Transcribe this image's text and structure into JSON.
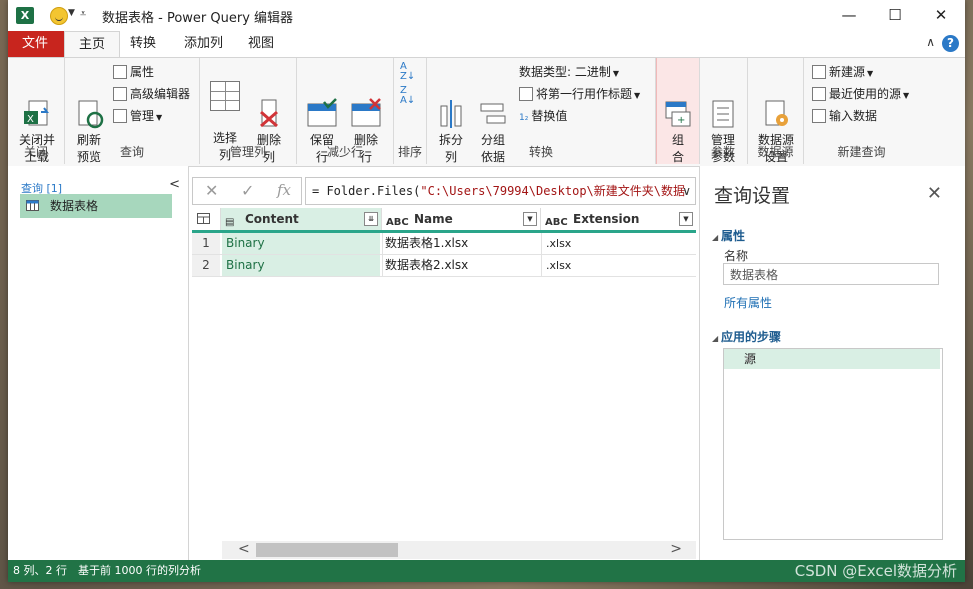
{
  "window": {
    "title": "数据表格 - Power Query 编辑器",
    "app_icon_letter": "X",
    "controls": {
      "minimize": "—",
      "maximize": "☐",
      "close": "✕"
    }
  },
  "tabs": [
    {
      "label": "文件"
    },
    {
      "label": "主页"
    },
    {
      "label": "转换"
    },
    {
      "label": "添加列"
    },
    {
      "label": "视图"
    }
  ],
  "ribbon": {
    "close_group": {
      "label": "关闭",
      "close_load": "关闭并\n上载"
    },
    "query_group": {
      "label": "查询",
      "refresh": "刷新\n预览",
      "properties": "属性",
      "advanced_editor": "高级编辑器",
      "manage": "管理"
    },
    "manage_cols_group": {
      "label": "管理列",
      "choose_cols": "选择\n列",
      "remove_cols": "删除\n列"
    },
    "reduce_rows_group": {
      "label": "减少行",
      "keep_rows": "保留\n行",
      "remove_rows": "删除\n行"
    },
    "sort_group": {
      "label": "排序"
    },
    "transform_group": {
      "label": "转换",
      "split": "拆分\n列",
      "group_by": "分组\n依据",
      "data_type": "数据类型: 二进制",
      "first_row_header": "将第一行用作标题",
      "replace_values": "替换值"
    },
    "combine_group": {
      "label": "",
      "combine": "组\n合"
    },
    "params_group": {
      "label": "参数",
      "manage_params": "管理\n参数"
    },
    "datasource_group": {
      "label": "数据源",
      "ds_settings": "数据源\n设置"
    },
    "newquery_group": {
      "label": "新建查询",
      "new_source": "新建源",
      "recent_sources": "最近使用的源",
      "enter_data": "输入数据"
    }
  },
  "left_pane": {
    "header": "查询 [1]",
    "queries": [
      {
        "name": "数据表格"
      }
    ]
  },
  "formula_bar": {
    "prefix": "= Folder.Files(",
    "string": "\"C:\\Users\\79994\\Desktop\\新建文件夹\\数据",
    "fx": "fx"
  },
  "grid": {
    "columns": [
      {
        "name": "Content",
        "type_icon": "▤"
      },
      {
        "name": "Name",
        "type_icon": "ABC"
      },
      {
        "name": "Extension",
        "type_icon": "ABC"
      }
    ],
    "rows": [
      {
        "num": "1",
        "content": "Binary",
        "name": "数据表格1.xlsx",
        "ext": ".xlsx"
      },
      {
        "num": "2",
        "content": "Binary",
        "name": "数据表格2.xlsx",
        "ext": ".xlsx"
      }
    ]
  },
  "right_pane": {
    "title": "查询设置",
    "properties_header": "属性",
    "name_label": "名称",
    "name_value": "数据表格",
    "all_properties": "所有属性",
    "steps_header": "应用的步骤",
    "steps": [
      {
        "name": "源"
      }
    ]
  },
  "status": {
    "cols_rows": "8 列、2 行",
    "profile": "基于前 1000 行的列分析"
  },
  "watermark": "CSDN @Excel数据分析"
}
